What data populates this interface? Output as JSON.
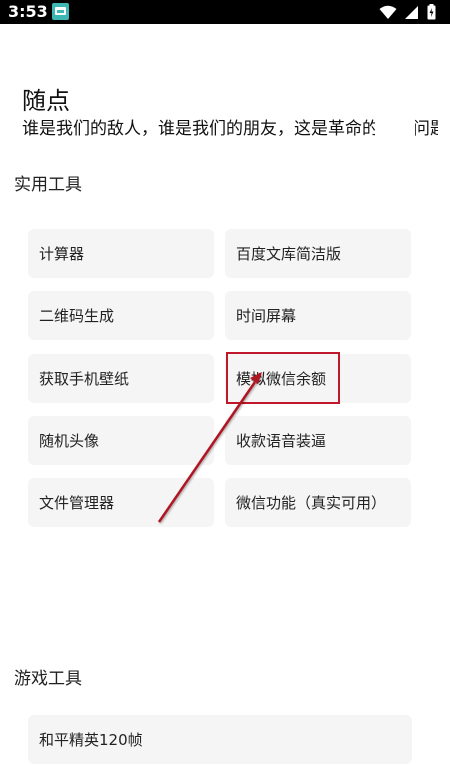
{
  "statusbar": {
    "time": "3:53",
    "icons": [
      "app-notification-icon",
      "wifi-icon",
      "signal-icon",
      "battery-charging-icon"
    ]
  },
  "header": {
    "title": "随点",
    "quote": "谁是我们的敌人，谁是我们的朋友，这是革命的首要问题"
  },
  "sections": {
    "practical": {
      "title": "实用工具",
      "items": [
        "计算器",
        "百度文库简洁版",
        "二维码生成",
        "时间屏幕",
        "获取手机壁纸",
        "模拟微信余额",
        "随机头像",
        "收款语音装逼",
        "文件管理器",
        "微信功能（真实可用）"
      ]
    },
    "games": {
      "title": "游戏工具",
      "items": [
        "和平精英120帧"
      ]
    }
  },
  "annotation": {
    "highlight_color": "#c0182a",
    "arrow_color": "#b01522",
    "target": "模拟微信余额"
  }
}
